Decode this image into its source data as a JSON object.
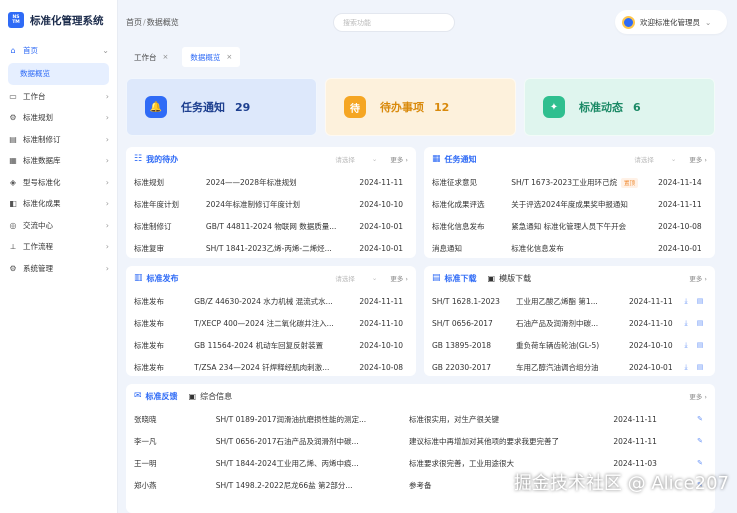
{
  "app": {
    "logo_top": "NS",
    "logo_bottom": "TM",
    "title": "标准化管理系统"
  },
  "breadcrumb": {
    "home": "首页",
    "sep": "/",
    "current": "数据概览"
  },
  "search": {
    "placeholder": "搜索功能"
  },
  "user": {
    "greeting": "欢迎标准化管理员"
  },
  "sidebar": {
    "items": [
      {
        "label": "首页",
        "icon": "home-icon"
      },
      {
        "label": "工作台",
        "icon": "desk-icon"
      },
      {
        "label": "标准规划",
        "icon": "gear-icon"
      },
      {
        "label": "标准制修订",
        "icon": "edit-icon"
      },
      {
        "label": "标准数据库",
        "icon": "database-icon"
      },
      {
        "label": "型号标准化",
        "icon": "model-icon"
      },
      {
        "label": "标准化成果",
        "icon": "result-icon"
      },
      {
        "label": "交流中心",
        "icon": "chat-icon"
      },
      {
        "label": "工作流程",
        "icon": "flow-icon"
      },
      {
        "label": "系统管理",
        "icon": "settings-icon"
      }
    ],
    "sub_active": "数据概览"
  },
  "tabs": [
    {
      "label": "工作台"
    },
    {
      "label": "数据概览"
    }
  ],
  "stats": [
    {
      "label": "任务通知",
      "count": "29",
      "icon_glyph": "🔔",
      "color": "#2f6bf6",
      "bg": "#dde8fb",
      "text": "#1d3f8f"
    },
    {
      "label": "待办事项",
      "count": "12",
      "icon_glyph": "待",
      "color": "#f5a623",
      "bg": "#fdf1dc",
      "text": "#d98a0c"
    },
    {
      "label": "标准动态",
      "count": "6",
      "icon_glyph": "✦",
      "color": "#2fbf8f",
      "bg": "#dff5ee",
      "text": "#1c8a66"
    }
  ],
  "todo": {
    "title": "我的待办",
    "select": "请选择",
    "more": "更多 ›",
    "rows": [
      [
        "标准规划",
        "2024——2028年标准规划",
        "2024-11-11"
      ],
      [
        "标准年度计划",
        "2024年标准制修订年度计划",
        "2024-10-10"
      ],
      [
        "标准制修订",
        "GB/T 44811-2024 物联网 数据质量...",
        "2024-10-01"
      ],
      [
        "标准复审",
        "SH/T 1841-2023乙烯-丙烯-二烯烃...",
        "2024-10-01"
      ]
    ]
  },
  "notice": {
    "title": "任务通知",
    "select": "请选择",
    "more": "更多 ›",
    "tag": "置顶",
    "rows": [
      [
        "标准征求意见",
        "SH/T 1673-2023工业用环己烷",
        "2024-11-14"
      ],
      [
        "标准化成果评选",
        "关于评选2024年度成果奖申报通知",
        "2024-11-11"
      ],
      [
        "标准化信息发布",
        "紧急通知 标准化管理人员下午开会",
        "2024-10-08"
      ],
      [
        "消息通知",
        "标准化信息发布",
        "2024-10-01"
      ]
    ]
  },
  "publish": {
    "title": "标准发布",
    "select": "请选择",
    "more": "更多 ›",
    "rows": [
      [
        "标准发布",
        "GB/Z 44630-2024 水力机械 混流式水...",
        "2024-11-11"
      ],
      [
        "标准发布",
        "T/XECP 400—2024 注二氧化碳井注入...",
        "2024-11-10"
      ],
      [
        "标准发布",
        "GB 11564-2024  机动车回复反射装置",
        "2024-10-10"
      ],
      [
        "标准发布",
        "T/ZSA 234—2024 钎焊释经肌肉刺激...",
        "2024-10-08"
      ]
    ]
  },
  "download": {
    "title": "标准下载",
    "title2": "模版下载",
    "more": "更多 ›",
    "rows": [
      [
        "SH/T 1628.1-2023",
        "工业用乙酸乙烯酯 第1...",
        "2024-11-11"
      ],
      [
        "SH/T 0656-2017",
        "石油产品及润滑剂中碳...",
        "2024-11-10"
      ],
      [
        "GB 13895-2018",
        "重负荷车辆齿轮油(GL-5)",
        "2024-10-10"
      ],
      [
        "GB 22030-2017",
        "车用乙醇汽油调合组分油",
        "2024-10-01"
      ]
    ]
  },
  "feedback": {
    "title": "标准反馈",
    "title2": "综合信息",
    "more": "更多 ›",
    "rows": [
      [
        "张晓晓",
        "SH/T 0189-2017润滑油抗磨损性能的测定...",
        "标准很实用，对生产很关键",
        "2024-11-11"
      ],
      [
        "李一凡",
        "SH/T 0656-2017石油产品及润滑剂中碳...",
        "建议标准中再增加对其他项的要求我更完善了",
        "2024-11-11"
      ],
      [
        "王一明",
        "SH/T 1844-2024工业用乙烯、丙烯中痕...",
        "标准要求很完善，工业用途很大",
        "2024-11-03"
      ],
      [
        "郑小燕",
        "SH/T 1498.2-2022尼龙66盐 第2部分...",
        "参考备",
        ""
      ]
    ]
  },
  "watermark": "掘金技术社区 @ Alice207"
}
